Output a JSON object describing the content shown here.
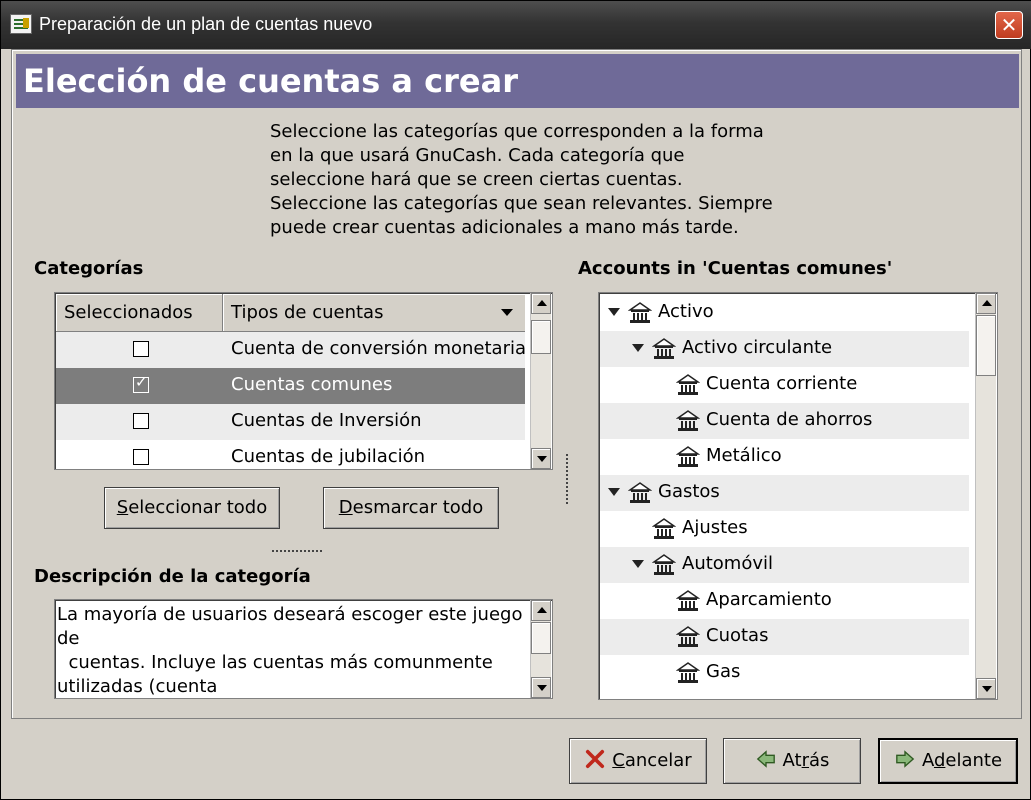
{
  "window": {
    "title": "Preparación de un plan de cuentas nuevo",
    "close_icon": "close-icon"
  },
  "page": {
    "heading": "Elección de cuentas a crear",
    "intro_lines": [
      "Seleccione las categorías que corresponden a la forma",
      "en la que usará GnuCash. Cada categoría que",
      "seleccione hará que se creen ciertas cuentas.",
      "Seleccione las categorías que sean relevantes. Siempre",
      "puede crear cuentas adicionales a mano más tarde."
    ],
    "accent_color": "#6f6a98"
  },
  "categories": {
    "label": "Categorías",
    "col_selected": "Seleccionados",
    "col_types": "Tipos de cuentas",
    "rows": [
      {
        "label": "Cuenta de conversión monetaria",
        "checked": false
      },
      {
        "label": "Cuentas comunes",
        "checked": true
      },
      {
        "label": "Cuentas de Inversión",
        "checked": false
      },
      {
        "label": "Cuentas de jubilación",
        "checked": false
      }
    ],
    "select_all": "Seleccionar todo",
    "select_all_mnemonic": "S",
    "select_all_rest": "eleccionar todo",
    "unselect_all": "Desmarcar todo",
    "unselect_all_mnemonic": "D",
    "unselect_all_rest": "esmarcar todo"
  },
  "description": {
    "label": "Descripción de la categoría",
    "text": "La mayoría de usuarios deseará escoger este juego\nde\n  cuentas. Incluye las cuentas más comunmente\nutilizadas (cuenta"
  },
  "accounts": {
    "label": "Accounts in 'Cuentas comunes'",
    "rows": [
      {
        "label": "Activo",
        "depth": 0,
        "expander": true
      },
      {
        "label": "Activo circulante",
        "depth": 1,
        "expander": true
      },
      {
        "label": "Cuenta corriente",
        "depth": 2,
        "expander": false
      },
      {
        "label": "Cuenta de ahorros",
        "depth": 2,
        "expander": false
      },
      {
        "label": "Metálico",
        "depth": 2,
        "expander": false
      },
      {
        "label": "Gastos",
        "depth": 0,
        "expander": true
      },
      {
        "label": "Ajustes",
        "depth": 1,
        "expander": false
      },
      {
        "label": "Automóvil",
        "depth": 1,
        "expander": true
      },
      {
        "label": "Aparcamiento",
        "depth": 2,
        "expander": false
      },
      {
        "label": "Cuotas",
        "depth": 2,
        "expander": false
      },
      {
        "label": "Gas",
        "depth": 2,
        "expander": false
      }
    ]
  },
  "footer": {
    "cancel_u": "C",
    "cancel_rest": "ancelar",
    "back_pre": "At",
    "back_u": "r",
    "back_rest": "ás",
    "forward_pre": "A",
    "forward_u": "d",
    "forward_rest": "elante"
  }
}
